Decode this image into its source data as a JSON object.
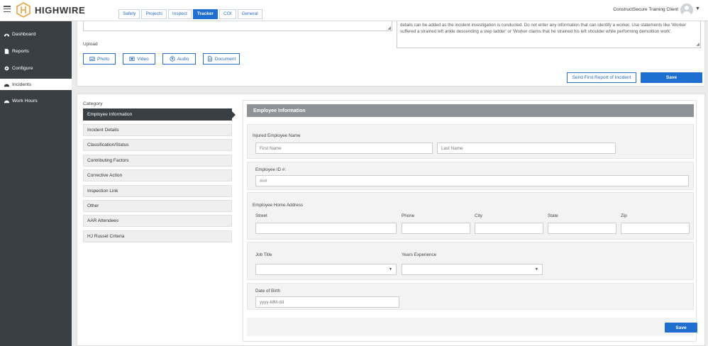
{
  "app": {
    "name": "HIGHWIRE",
    "client": "ConstructSecure Training Client"
  },
  "tabs": [
    {
      "label": "Safety",
      "active": false
    },
    {
      "label": "Projects",
      "active": false
    },
    {
      "label": "Inspect",
      "active": false
    },
    {
      "label": "Tracker",
      "active": true
    },
    {
      "label": "COI",
      "active": false
    },
    {
      "label": "General",
      "active": false
    }
  ],
  "sidebar": {
    "items": [
      {
        "label": "Dashboard",
        "icon": "dashboard-icon"
      },
      {
        "label": "Reports",
        "icon": "document-icon"
      },
      {
        "label": "Configure",
        "icon": "gear-icon"
      },
      {
        "label": "Incidents",
        "icon": "gauge-icon",
        "active": true
      },
      {
        "label": "Work Hours",
        "icon": "gauge-icon"
      }
    ]
  },
  "top": {
    "description_text": "details can be added as the incident investigation is conducted.  Do not enter any information that can identify a worker.  Use statements like 'Worker suffered a strained left ankle descending a step ladder' or 'Worker claims that he strained his left shoulder while performing demolition work'.",
    "upload_label": "Upload",
    "upload_buttons": [
      {
        "label": "Photo",
        "icon": "photo-icon"
      },
      {
        "label": "Video",
        "icon": "video-icon"
      },
      {
        "label": "Audio",
        "icon": "audio-icon"
      },
      {
        "label": "Document",
        "icon": "document-icon"
      }
    ],
    "send_report_label": "Send First Report of Incident",
    "save_label": "Save"
  },
  "category": {
    "label": "Category",
    "items": [
      {
        "label": "Employee Information",
        "active": true
      },
      {
        "label": "Incident Details"
      },
      {
        "label": "Classification/Status"
      },
      {
        "label": "Contributing Factors"
      },
      {
        "label": "Corrective Action"
      },
      {
        "label": "Inspection Link"
      },
      {
        "label": "Other"
      },
      {
        "label": "AAR Attendees"
      },
      {
        "label": "HJ Russel Criteria"
      }
    ]
  },
  "form": {
    "title": "Employee Information",
    "injured_name_label": "Injured Employee Name",
    "first_name_placeholder": "First Name",
    "last_name_placeholder": "Last Name",
    "employee_id_label": "Employee ID #:",
    "employee_id_placeholder": "###",
    "address_label": "Employee Home Address",
    "street_label": "Street",
    "phone_label": "Phone",
    "city_label": "City",
    "state_label": "State",
    "zip_label": "Zip",
    "job_title_label": "Job Title",
    "years_experience_label": "Years Experience",
    "dob_label": "Date of Birth",
    "dob_placeholder": "yyyy-MM-dd",
    "save_label": "Save"
  },
  "colors": {
    "primary": "#1f6fd1",
    "sidebar": "#3a3f44",
    "logo": "#e8a33d",
    "header_bar": "#8e9397"
  }
}
